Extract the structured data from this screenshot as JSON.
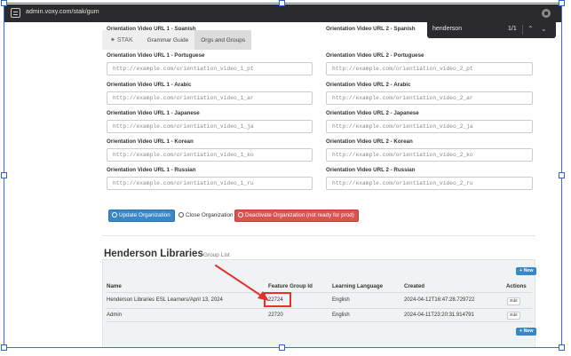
{
  "browser": {
    "url": "admin.voxy.com/stak/gum"
  },
  "find_bar": {
    "query": "henderson",
    "count": "1/1"
  },
  "nav": {
    "brand": "STAK",
    "tabs": [
      "Grammar Guide",
      "Orgs and Groups"
    ],
    "active_tab": "Orgs and Groups"
  },
  "form": {
    "partial_labels": {
      "col1": "Orientation Video URL 1 - Spanish",
      "col2": "Orientation Video URL 2 - Spanish"
    },
    "rows": [
      {
        "label1": "Orientation Video URL 1 - Portuguese",
        "value1": "http://example.com/orientiation_video_1_pt",
        "label2": "Orientation Video URL 2 - Portuguese",
        "value2": "http://example.com/orientiation_video_2_pt"
      },
      {
        "label1": "Orientation Video URL 1 - Arabic",
        "value1": "http://example.com/orientiation_video_1_ar",
        "label2": "Orientation Video URL 2 - Arabic",
        "value2": "http://example.com/orientiation_video_2_ar"
      },
      {
        "label1": "Orientation Video URL 1 - Japanese",
        "value1": "http://example.com/orientiation_video_1_ja",
        "label2": "Orientation Video URL 2 - Japanese",
        "value2": "http://example.com/orientiation_video_2_ja"
      },
      {
        "label1": "Orientation Video URL 1 - Korean",
        "value1": "http://example.com/orientiation_video_1_ko",
        "label2": "Orientation Video URL 2 - Korean",
        "value2": "http://example.com/orientiation_video_2_ko"
      },
      {
        "label1": "Orientation Video URL 1 - Russian",
        "value1": "http://example.com/orientiation_video_1_ru",
        "label2": "Orientation Video URL 2 - Russian",
        "value2": "http://example.com/orientiation_video_2_ru"
      }
    ]
  },
  "actions": {
    "update": "Update Organization",
    "close": "Close Organization",
    "deactivate": "Deactivate Organization (not ready for prod)"
  },
  "group_list": {
    "org_name": "Henderson Libraries",
    "subtitle": "Group List",
    "new_button": "+ New",
    "columns": [
      "Name",
      "Feature Group Id",
      "Learning Language",
      "Created",
      "Actions"
    ],
    "rows": [
      {
        "name": "Henderson Libraries ESL Learners/April 13, 2024",
        "feature_group_id": "22724",
        "language": "English",
        "created": "2024-04-12T16:47:28.729722",
        "action": "Edit"
      },
      {
        "name": "Admin",
        "feature_group_id": "22720",
        "language": "English",
        "created": "2024-04-11T23:20:31.914791",
        "action": "Edit"
      }
    ]
  },
  "colors": {
    "primary": "#3a87c8",
    "danger": "#d9534f",
    "annotation": "#e5302b",
    "browser_chrome": "#2b2b2d",
    "selection": "#3b6fd6"
  },
  "icons": {
    "site": "site-settings-icon",
    "extension": "extension-icon",
    "find_up": "chevron-up-icon",
    "find_down": "chevron-down-icon",
    "brand": "stak-logo-icon",
    "update": "circle-arrow-up-icon",
    "close": "circle-dot-icon",
    "deactivate": "ban-icon"
  },
  "annotation": {
    "arrow": "red-arrow",
    "highlight": "red-highlight-box"
  }
}
